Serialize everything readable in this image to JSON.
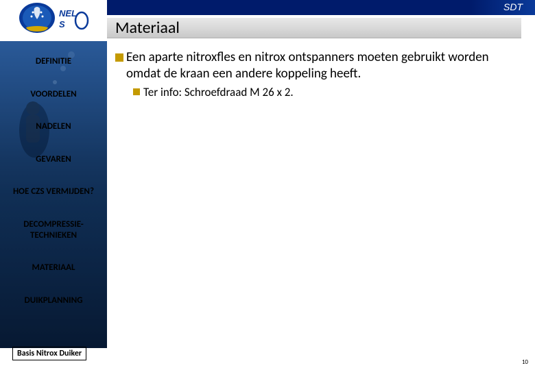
{
  "header": {
    "sdt": "SDT",
    "title": "Materiaal"
  },
  "sidebar": {
    "items": [
      {
        "label": "DEFINITIE"
      },
      {
        "label": "VOORDELEN"
      },
      {
        "label": "NADELEN"
      },
      {
        "label": "GEVAREN"
      },
      {
        "label": "HOE CZS VERMIJDEN?"
      },
      {
        "label": "DECOMPRESSIE-TECHNIEKEN"
      },
      {
        "label": "MATERIAAL"
      },
      {
        "label": "DUIKPLANNING"
      }
    ]
  },
  "content": {
    "main_bullet": "Een aparte nitroxfles en nitrox ontspanners moeten gebruikt worden omdat de kraan een andere koppeling heeft.",
    "sub_bullet_prefix": "Ter",
    "sub_bullet_rest": " info: Schroefdraad M 26 x 2."
  },
  "footer": {
    "box": "Basis Nitrox Duiker",
    "page": "10"
  },
  "colors": {
    "brand_blue": "#001b6b",
    "bullet_gold": "#c49a00"
  }
}
